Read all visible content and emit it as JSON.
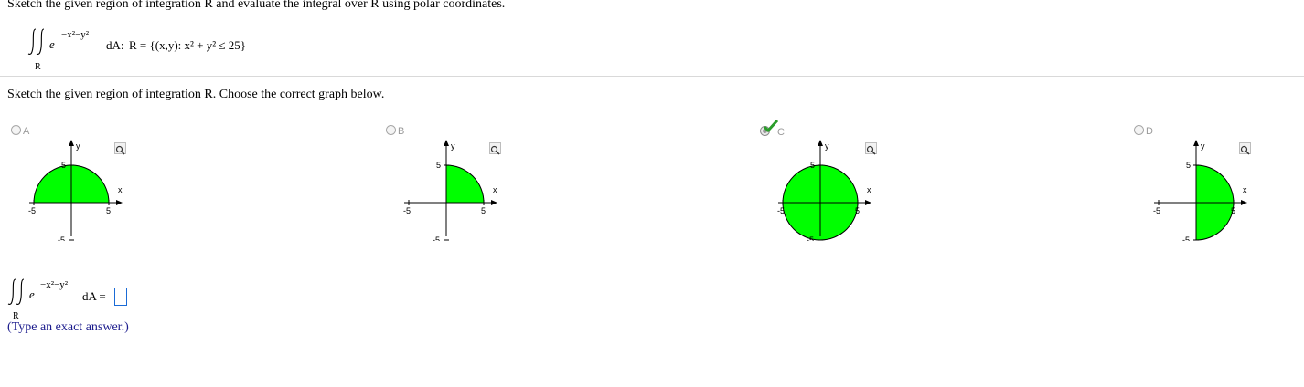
{
  "question": {
    "prompt": "Sketch the given region of integration R and evaluate the integral over R using polar coordinates.",
    "integrand_base": "e",
    "integrand_exponent": "−x²−y²",
    "differential": "dA:",
    "region_def": "R = {(x,y): x² + y² ≤ 25}",
    "region_label": "R"
  },
  "part1": {
    "prompt": "Sketch the given region of integration R. Choose the correct graph below.",
    "options": [
      {
        "letter": "A",
        "selected": false,
        "region": "upper half disk"
      },
      {
        "letter": "B",
        "selected": false,
        "region": "first quadrant"
      },
      {
        "letter": "C",
        "selected": true,
        "region": "full disk"
      },
      {
        "letter": "D",
        "selected": false,
        "region": "right half disk"
      }
    ],
    "axis": {
      "x_label": "x",
      "y_label": "y",
      "tick_pos": "5",
      "tick_neg": "-5",
      "radius": 5
    },
    "fill_color": "#00ff00",
    "correct_mark_color": "#2a9d2a"
  },
  "part2": {
    "integrand_base": "e",
    "integrand_exponent": "−x²−y²",
    "differential": "dA =",
    "region_label": "R",
    "answer_value": "",
    "hint": "(Type an exact answer.)"
  }
}
